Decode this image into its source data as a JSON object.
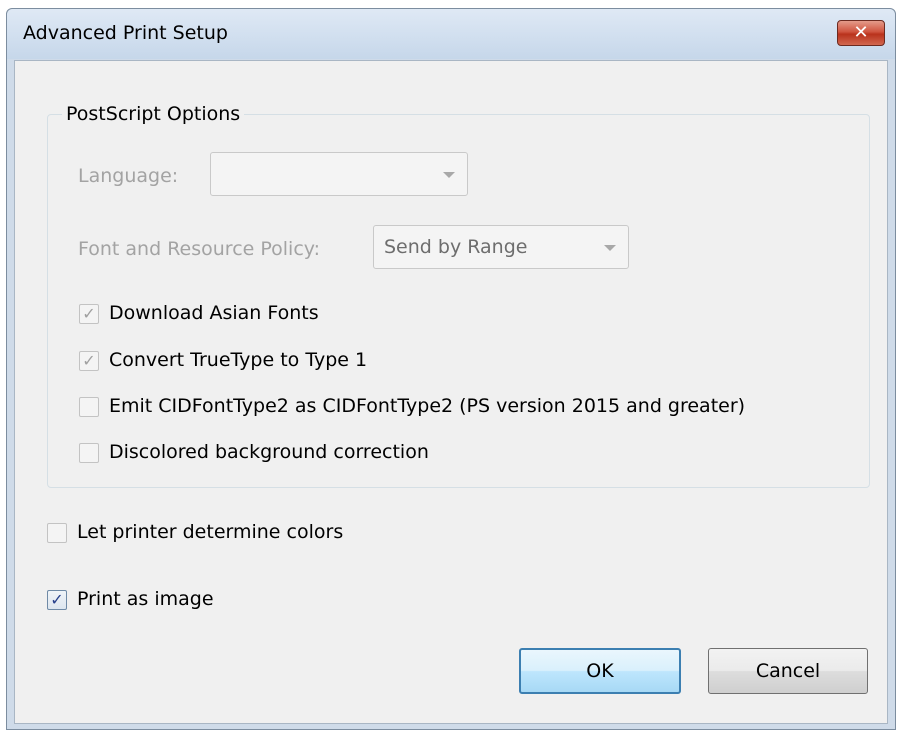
{
  "window": {
    "title": "Advanced Print Setup",
    "close_glyph": "✕"
  },
  "postscript": {
    "group_label": "PostScript Options",
    "language": {
      "label": "Language:",
      "value": ""
    },
    "font_policy": {
      "label": "Font and Resource Policy:",
      "value": "Send by Range"
    },
    "options": [
      {
        "label": "Download Asian Fonts",
        "checked": true,
        "enabled": false
      },
      {
        "label": "Convert TrueType to Type 1",
        "checked": true,
        "enabled": false
      },
      {
        "label": "Emit CIDFontType2 as CIDFontType2 (PS version 2015 and greater)",
        "checked": false,
        "enabled": false
      },
      {
        "label": "Discolored background correction",
        "checked": false,
        "enabled": false
      }
    ]
  },
  "let_printer_colors": {
    "label": "Let printer determine colors",
    "checked": false,
    "enabled": false
  },
  "print_as_image": {
    "label": "Print as image",
    "checked": true,
    "enabled": true
  },
  "buttons": {
    "ok": "OK",
    "cancel": "Cancel"
  },
  "check_glyph": "✓"
}
